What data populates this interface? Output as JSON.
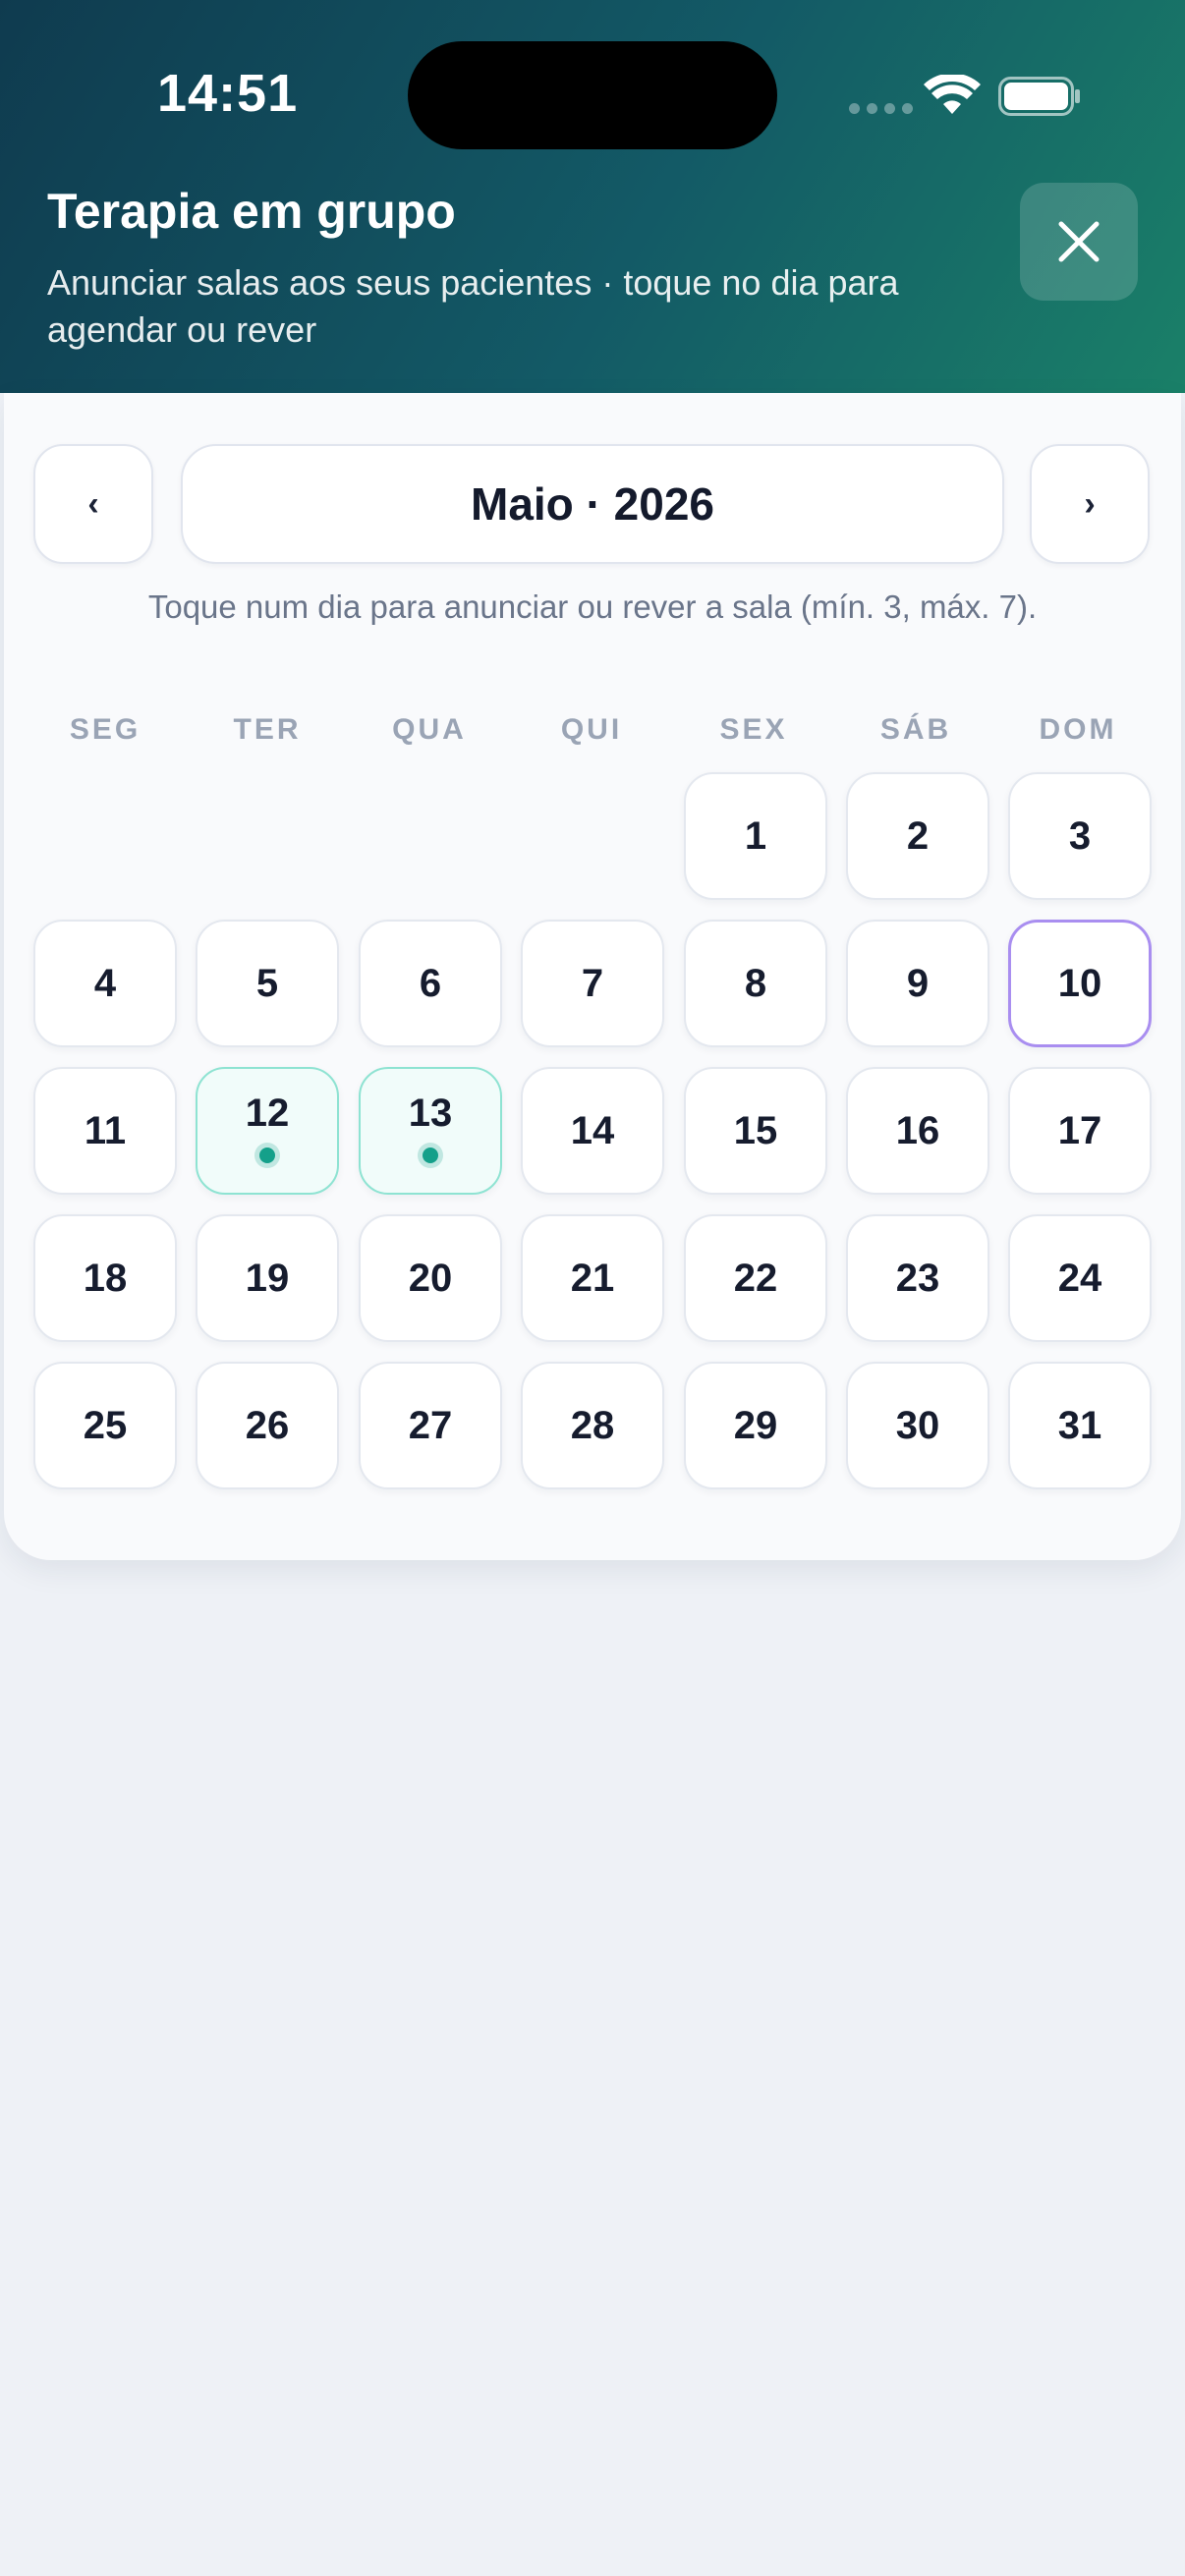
{
  "status_bar": {
    "time": "14:51"
  },
  "header": {
    "title": "Terapia em grupo",
    "subtitle": "Anunciar salas aos seus pacientes · toque no dia para agendar ou rever",
    "close_icon": "close-icon"
  },
  "calendar": {
    "prev_label": "‹",
    "next_label": "›",
    "month_label": "Maio · 2026",
    "hint": "Toque num dia para anunciar ou rever a sala (mín. 3, máx. 7).",
    "weekdays": [
      "SEG",
      "TER",
      "QUA",
      "QUI",
      "SEX",
      "SÁB",
      "DOM"
    ],
    "days": [
      "1",
      "2",
      "3",
      "4",
      "5",
      "6",
      "7",
      "8",
      "9",
      "10",
      "11",
      "12",
      "13",
      "14",
      "15",
      "16",
      "17",
      "18",
      "19",
      "20",
      "21",
      "22",
      "23",
      "24",
      "25",
      "26",
      "27",
      "28",
      "29",
      "30",
      "31"
    ],
    "first_weekday_index": 4,
    "today": "10",
    "booked_days": [
      "12",
      "13"
    ]
  },
  "colors": {
    "header_start": "#0f3b4f",
    "header_end": "#1a8068",
    "today_border": "#a98ef0",
    "booked_border": "#8ee3d2",
    "booked_dot": "#14a08a"
  }
}
